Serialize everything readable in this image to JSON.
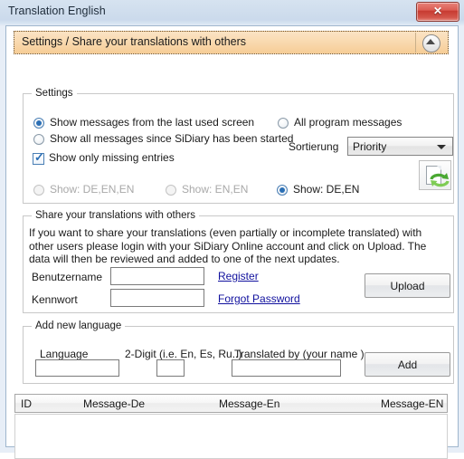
{
  "window": {
    "title": "Translation English",
    "close_label": "✕"
  },
  "panel": {
    "header_label": "Settings / Share your translations with others",
    "collapse_icon": "chevron-up-icon"
  },
  "settings": {
    "group_title": "Settings",
    "radios_primary": [
      {
        "label": "Show messages from the last used screen",
        "checked": true,
        "disabled": false
      },
      {
        "label": "Show all messages since SiDiary has been started",
        "checked": false,
        "disabled": false
      },
      {
        "label": "All program messages",
        "checked": false,
        "disabled": false
      }
    ],
    "checkbox": {
      "label": "Show only missing entries",
      "checked": true
    },
    "sortierung": {
      "label": "Sortierung",
      "value": "Priority",
      "options": [
        "Priority"
      ]
    },
    "refresh_icon": "refresh-page-icon",
    "show_radios": [
      {
        "label": "Show: DE,EN,EN",
        "checked": false,
        "disabled": true
      },
      {
        "label": "Show: EN,EN",
        "checked": false,
        "disabled": true
      },
      {
        "label": "Show: DE,EN",
        "checked": true,
        "disabled": false
      }
    ]
  },
  "share": {
    "group_title": "Share your translations with others",
    "description": "If you want to share your translations (even partially or incomplete translated) with other users please login with your SiDiary Online account and click on Upload. The data will then be reviewed and added to one of the next updates.",
    "username_label": "Benutzername",
    "username_value": "",
    "password_label": "Kennwort",
    "password_value": "",
    "register_link": "Register",
    "forgot_link": "Forgot Password",
    "upload_button": "Upload"
  },
  "add_language": {
    "group_title": "Add new language",
    "language_label": "Language",
    "language_value": "",
    "digit_label": "2-Digit (i.e. En, Es, Ru..)",
    "digit_value": "",
    "translated_by_label": "Translated by (your name )",
    "translated_by_value": "",
    "add_button": "Add"
  },
  "list": {
    "columns": [
      "ID",
      "Message-De",
      "Message-En",
      "Message-EN"
    ],
    "rows": []
  },
  "colors": {
    "panel_header_start": "#fbe3c4",
    "panel_header_end": "#f6cd96",
    "accent_blue": "#2b6fb5",
    "link": "#11119e",
    "close_red": "#c63a31"
  }
}
